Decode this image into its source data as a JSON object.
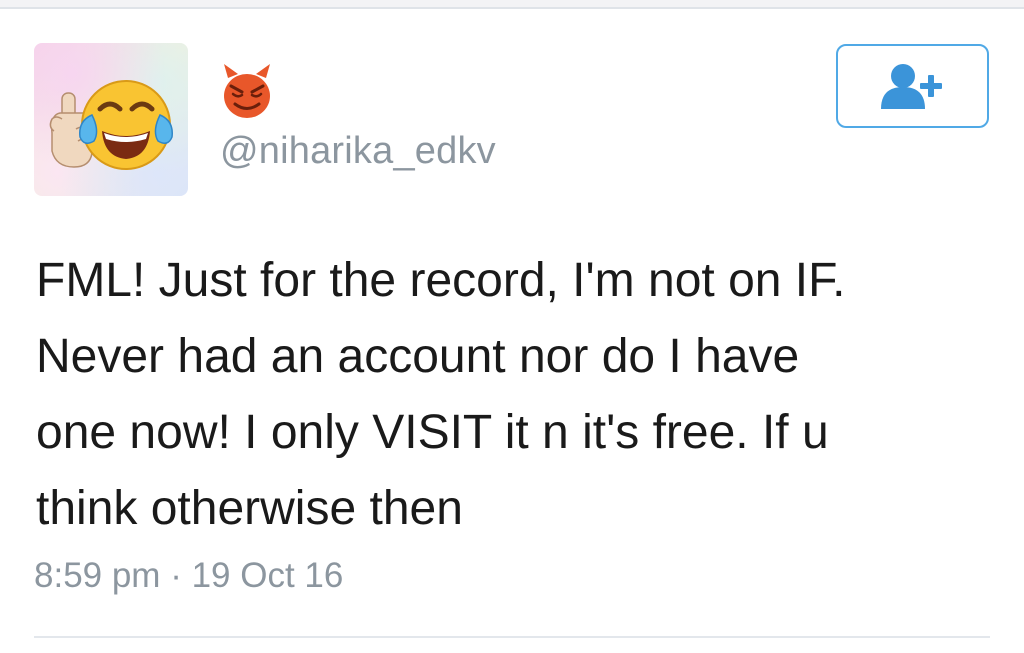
{
  "tweet": {
    "avatar_icon": "laughing-crying-emoji-icon",
    "badge_icon": "smiling-devil-icon",
    "handle": "@niharika_edkv",
    "follow_button_icon": "follow-user-icon",
    "text_lines": [
      "FML! Just for the record, I'm not on IF.",
      "Never had an account nor do I have",
      "one now! I only VISIT it n it's free. If u",
      "think otherwise then"
    ],
    "timestamp": "8:59 pm · 19 Oct 16"
  },
  "colors": {
    "accent": "#50a9e6",
    "text": "#1a1a1a",
    "muted": "#8c969f",
    "devil": "#e8572a"
  }
}
